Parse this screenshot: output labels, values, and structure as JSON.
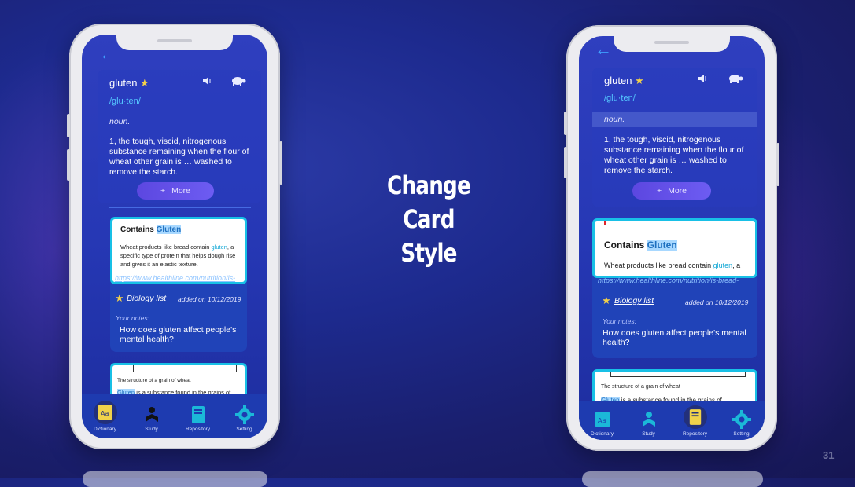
{
  "center_title": [
    "Change",
    "Card",
    "Style"
  ],
  "slide_number": "31",
  "phones": [
    {
      "word": "gluten",
      "phonetic": "/glu·ten/",
      "part_of_speech": "noun.",
      "definition_lines": [
        "1, the tough, viscid, nitrogenous",
        "substance remaining when the flour of",
        "wheat other grain is … washed to",
        "remove the starch."
      ],
      "more_label": "More",
      "ref_title_prefix": "Contains ",
      "ref_title_highlight": "Gluten",
      "ref_body_lines": [
        {
          "pre": "Wheat products like bread contain ",
          "hl": "gluten",
          "post": ", a"
        },
        {
          "pre": "specific type of protein that helps dough rise",
          "hl": "",
          "post": ""
        },
        {
          "pre": "and gives it an elastic texture.",
          "hl": "",
          "post": ""
        }
      ],
      "url": "https://www.healthline.com/nutrition/is-",
      "list_name": "Biology list",
      "added_on": "added on 10/12/2019",
      "notes_label": "Your notes:",
      "notes_lines": [
        "How does gluten affect people's",
        "mental health?"
      ],
      "img_caption": "The structure of a grain of wheat",
      "img_body_hl": "Gluten",
      "img_body_rest": " is a substance found in the grains of",
      "tabs": [
        {
          "label": "Dictionary",
          "icon": "dictionary-icon"
        },
        {
          "label": "Study",
          "icon": "study-icon"
        },
        {
          "label": "Repository",
          "icon": "repository-icon"
        },
        {
          "label": "Setting",
          "icon": "gear-icon"
        }
      ],
      "active_tab": "Dictionary"
    },
    {
      "word": "gluten",
      "phonetic": "/glu·ten/",
      "part_of_speech": "noun.",
      "definition_lines": [
        "1, the tough, viscid, nitrogenous",
        "substance remaining when the flour of",
        "wheat other grain is … washed to",
        "remove the starch."
      ],
      "more_label": "More",
      "ref_title_prefix": "Contains ",
      "ref_title_highlight": "Gluten",
      "ref_body_lines": [
        {
          "pre": "Wheat products like bread contain ",
          "hl": "gluten",
          "post": ", a"
        }
      ],
      "url": "https://www.healthline.com/nutrition/is-bread-",
      "list_name": "Biology list",
      "added_on": "added on 10/12/2019",
      "notes_label": "Your notes:",
      "notes_lines": [
        "How does gluten affect people's mental",
        "health?"
      ],
      "img_caption": "The structure of a grain of wheat",
      "img_body_hl": "Gluten",
      "img_body_rest": " is a substance found in the grains of",
      "tabs": [
        {
          "label": "Dictionary",
          "icon": "dictionary-icon"
        },
        {
          "label": "Study",
          "icon": "study-icon"
        },
        {
          "label": "Repository",
          "icon": "repository-icon"
        },
        {
          "label": "Setting",
          "icon": "gear-icon"
        }
      ],
      "active_tab": "Repository"
    }
  ]
}
